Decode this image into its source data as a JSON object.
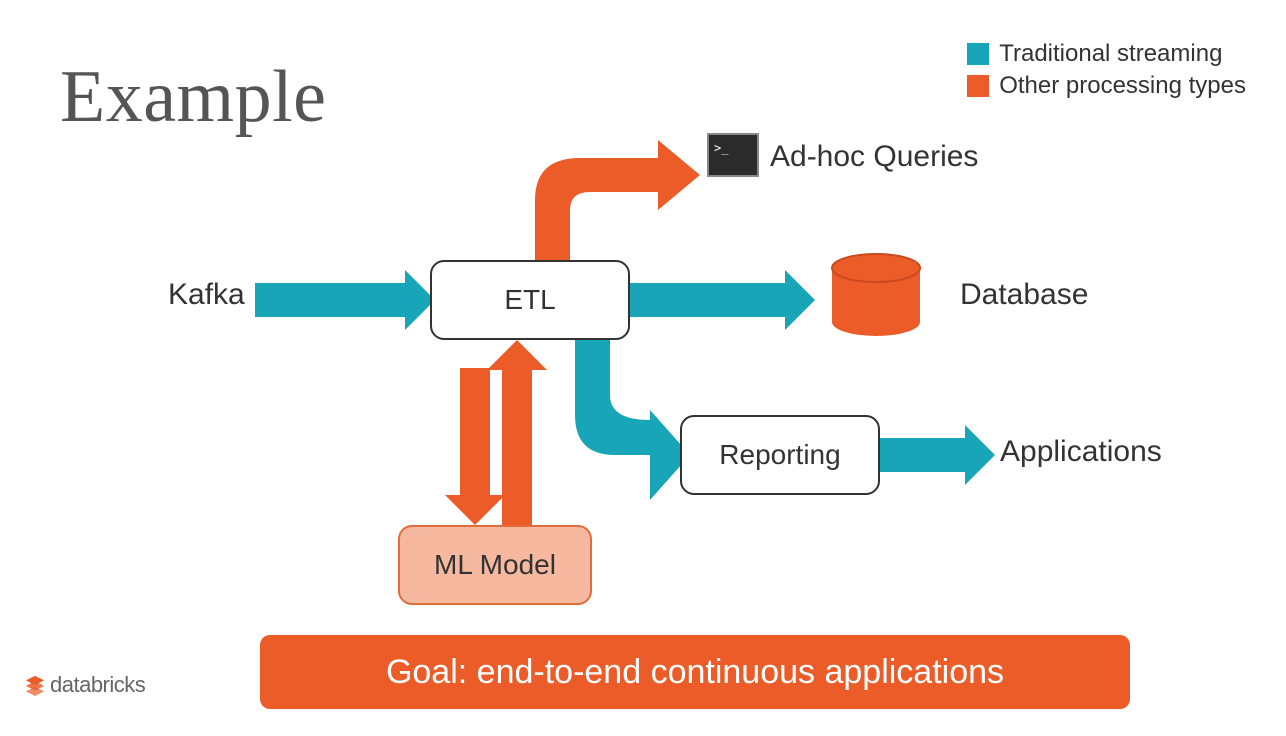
{
  "title": "Example",
  "colors": {
    "teal": "#18a5b8",
    "orange": "#eb5c29",
    "ml_fill": "#f7b8a0",
    "ml_stroke": "#e06d3a",
    "text": "#333333"
  },
  "legend": [
    {
      "color": "teal",
      "label": "Traditional streaming"
    },
    {
      "color": "orange",
      "label": "Other processing types"
    }
  ],
  "nodes": {
    "kafka": "Kafka",
    "etl": "ETL",
    "ml_model": "ML Model",
    "reporting": "Reporting",
    "adhoc": "Ad-hoc Queries",
    "database": "Database",
    "applications": "Applications"
  },
  "edges": [
    {
      "from": "kafka",
      "to": "etl",
      "type": "teal"
    },
    {
      "from": "etl",
      "to": "database",
      "type": "teal"
    },
    {
      "from": "etl",
      "to": "reporting",
      "type": "teal"
    },
    {
      "from": "reporting",
      "to": "applications",
      "type": "teal"
    },
    {
      "from": "etl",
      "to": "adhoc",
      "type": "orange"
    },
    {
      "from": "etl",
      "to": "ml_model",
      "type": "orange",
      "bidirectional": true
    }
  ],
  "goal": "Goal: end-to-end continuous applications",
  "brand": "databricks"
}
